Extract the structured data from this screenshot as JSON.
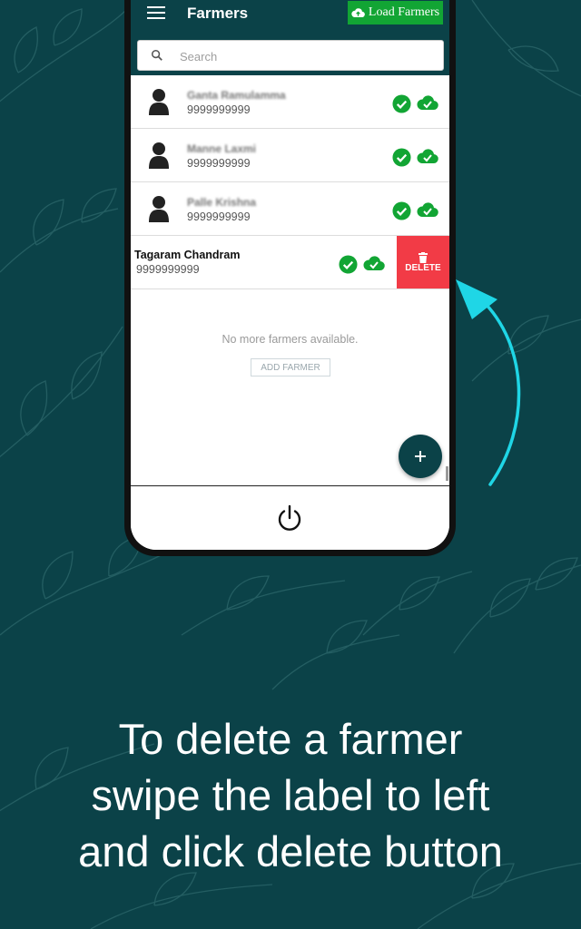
{
  "app": {
    "title": "Farmers",
    "load_button_label": "Load Farmers",
    "accent_color": "#0b4248",
    "load_button_color": "#12a534"
  },
  "search": {
    "placeholder": "Search",
    "value": ""
  },
  "farmers": [
    {
      "name": "Ganta Ramulamma",
      "phone": "9999999999",
      "icons": [
        "check-circle-icon",
        "cloud-check-icon"
      ]
    },
    {
      "name": "Manne Laxmi",
      "phone": "9999999999",
      "icons": [
        "check-circle-icon",
        "cloud-check-icon"
      ]
    },
    {
      "name": "Palle Krishna",
      "phone": "9999999999",
      "icons": [
        "check-circle-icon",
        "cloud-check-icon"
      ]
    },
    {
      "name": "Tagaram Chandram",
      "phone": "9999999999",
      "icons": [
        "check-circle-icon",
        "cloud-check-icon"
      ],
      "swiped": true
    }
  ],
  "delete_button": {
    "label": "DELETE",
    "color": "#f23b46"
  },
  "empty_state": {
    "message": "No more farmers available.",
    "add_button_label": "ADD FARMER"
  },
  "fab": {
    "icon": "plus-icon"
  },
  "bottom_bar": {
    "icon": "power-icon"
  },
  "caption": {
    "lines": [
      "To delete a farmer",
      "swipe the label to left",
      "and click delete button"
    ]
  }
}
